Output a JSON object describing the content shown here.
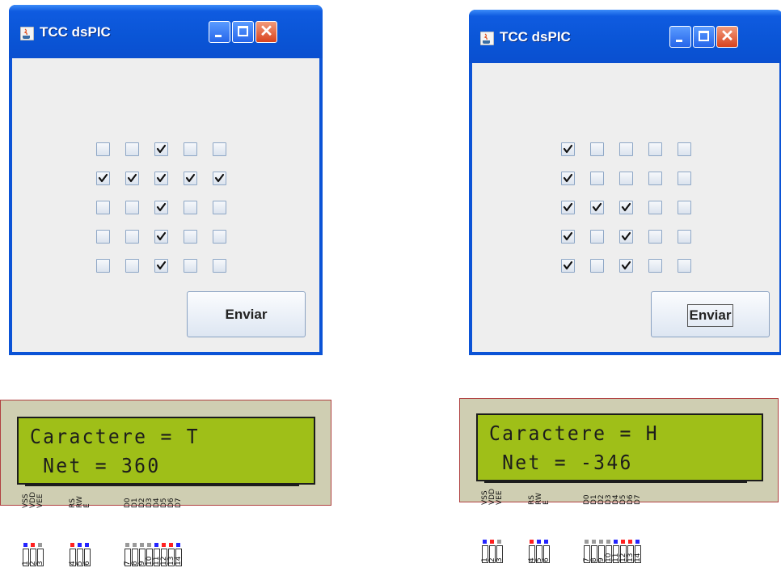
{
  "windows": [
    {
      "title": "TCC dsPIC",
      "button_label": "Enviar",
      "button_focused": false,
      "grid": [
        [
          false,
          false,
          true,
          false,
          false
        ],
        [
          true,
          true,
          true,
          true,
          true
        ],
        [
          false,
          false,
          true,
          false,
          false
        ],
        [
          false,
          false,
          true,
          false,
          false
        ],
        [
          false,
          false,
          true,
          false,
          false
        ]
      ]
    },
    {
      "title": "TCC dsPIC",
      "button_label": "Enviar",
      "button_focused": true,
      "grid": [
        [
          true,
          false,
          false,
          false,
          false
        ],
        [
          true,
          false,
          false,
          false,
          false
        ],
        [
          true,
          true,
          true,
          false,
          false
        ],
        [
          true,
          false,
          true,
          false,
          false
        ],
        [
          true,
          false,
          true,
          false,
          false
        ]
      ]
    }
  ],
  "lcds": [
    {
      "line1": "Caractere = T",
      "line2": " Net = 360"
    },
    {
      "line1": "Caractere = H",
      "line2": " Net = -346"
    }
  ],
  "lcd_pins": {
    "labels": [
      "VSS",
      "VDD",
      "VEE",
      "RS",
      "RW",
      "E",
      "D0",
      "D1",
      "D2",
      "D3",
      "D4",
      "D5",
      "D6",
      "D7"
    ],
    "numbers": [
      "1",
      "2",
      "3",
      "4",
      "5",
      "6",
      "7",
      "8",
      "9",
      "10",
      "11",
      "12",
      "13",
      "14"
    ],
    "dot_colors": [
      "#2323ff",
      "#ff2020",
      "#9a9a9a",
      "#ff2020",
      "#2323ff",
      "#2323ff",
      "#9a9a9a",
      "#9a9a9a",
      "#9a9a9a",
      "#9a9a9a",
      "#2323ff",
      "#ff2020",
      "#ff2020",
      "#2323ff"
    ]
  },
  "colors": {
    "titlebar": "#0a55d6",
    "lcd_screen": "#9fbf18",
    "lcd_board": "#cfceb2"
  }
}
